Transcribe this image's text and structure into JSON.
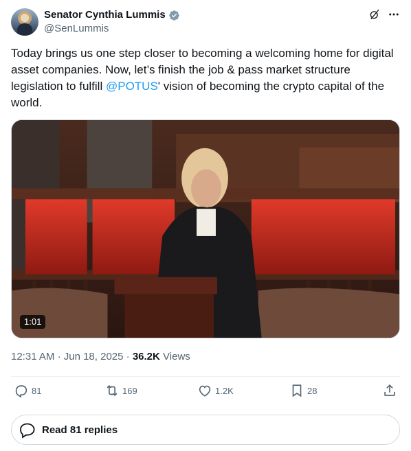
{
  "author": {
    "display_name": "Senator Cynthia Lummis",
    "handle": "@SenLummis"
  },
  "icons": {
    "verified": "verified-badge-icon",
    "grok": "grok-icon",
    "more": "more-icon",
    "reply": "reply-icon",
    "retweet": "retweet-icon",
    "like": "like-icon",
    "bookmark": "bookmark-icon",
    "share": "share-icon",
    "replies": "speech-bubble-icon"
  },
  "colors": {
    "text": "#0f1419",
    "secondary": "#536471",
    "link": "#1d9bf0",
    "verified": "#829aab"
  },
  "tweet": {
    "text_before": "Today brings us one step closer to becoming a welcoming home for digital asset companies. Now, let’s finish the job & pass market structure legislation to fulfill ",
    "mention": "@POTUS",
    "text_after": "' vision of becoming the crypto capital of the world."
  },
  "media": {
    "duration": "1:01"
  },
  "meta": {
    "time": "12:31 AM",
    "separator1": "·",
    "date": "Jun 18, 2025",
    "separator2": "·",
    "views_count": "36.2K",
    "views_label": "Views"
  },
  "actions": {
    "replies": "81",
    "reposts": "169",
    "likes": "1.2K",
    "bookmarks": "28"
  },
  "read_replies_label": "Read 81 replies"
}
